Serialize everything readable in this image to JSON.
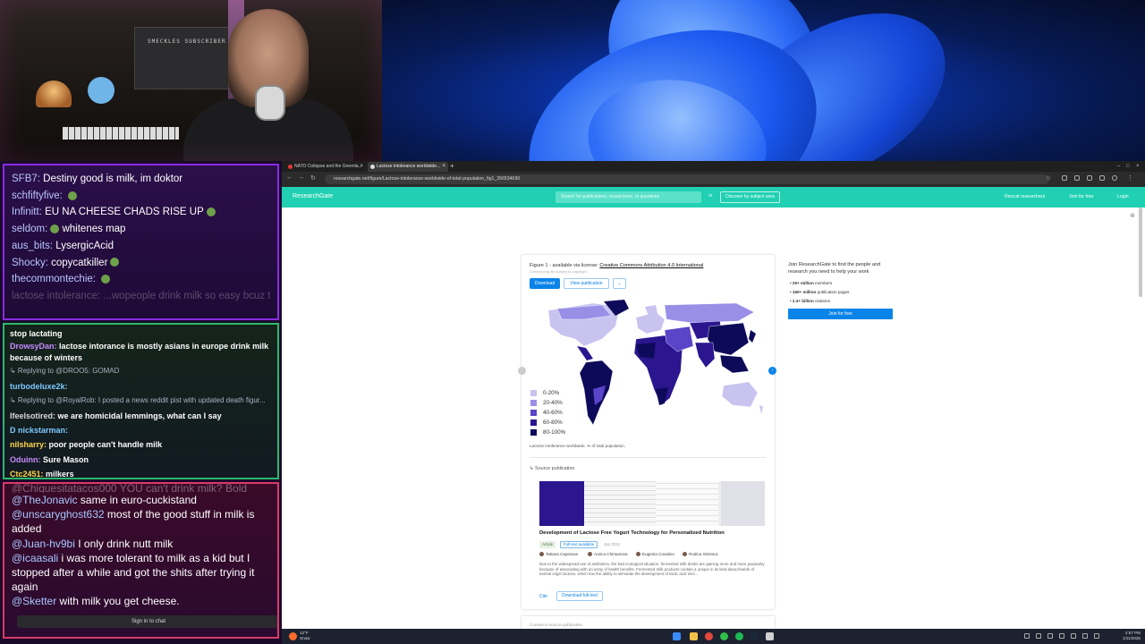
{
  "webcam": {
    "wall_text": "SMECKLES SUBSCRIBER"
  },
  "chat1": {
    "lines": [
      {
        "user": "SFB7:",
        "text": "Destiny good is milk, im doktor",
        "emote": ""
      },
      {
        "user": "schfiftyfive:",
        "text": "",
        "emote": "frog"
      },
      {
        "user": "Infinitt:",
        "text": "EU NA CHEESE CHADS RISE UP",
        "emote": "frog"
      },
      {
        "user": "seldom:",
        "text": "whitenes map",
        "emote": "frog"
      },
      {
        "user": "aus_bits:",
        "text": "LysergicAcid",
        "emote": ""
      },
      {
        "user": "Shocky:",
        "text": "copycatkiller",
        "emote": "frog"
      },
      {
        "user": "thecommontechie:",
        "text": "",
        "emote": "frog"
      }
    ],
    "faded": "lactose intolerance: ...wopeople drink milk so easy bcuz they ***"
  },
  "chat2": {
    "top_cut": "stop lactating",
    "l1_user": "DrowsyDan:",
    "l1_text": "lactose intorance is mostly asians in europe drink milk because of winters",
    "r1": "↳ Replying to @DROO5: GOMAD",
    "l2_user": "turbodeluxe2k:",
    "r2": "↳ Replying to @RoyalRob: I posted a news reddit pist with updated death figur...",
    "l3_user": "Ifeelsotired:",
    "l3_text": "we are homicidal lemmings, what can I say",
    "l4_user": "D nickstarman:",
    "l5_user": "nilsharry:",
    "l5_text": "poor people can't handle milk",
    "l6_user": "Oduinn:",
    "l6_text": "Sure Mason",
    "l7_user": "Ctc2451:",
    "l7_text": "milkers"
  },
  "chat3": {
    "cut": "@Chiquesitatacos000 YOU can't drink milk? Bold",
    "msgs": [
      {
        "user": "@TheJonavic",
        "text": "same in euro-cuckistand"
      },
      {
        "user": "@unscaryghost632",
        "text": "most of the good stuff in milk is added"
      },
      {
        "user": "@Juan-hv9bi",
        "text": "I only drink nutt milk"
      },
      {
        "user": "@icaasali",
        "text": "i was more tolerant to milk as a kid but I stopped after a while and got the shits after trying it again"
      },
      {
        "user": "@Sketter",
        "text": "with milk you get cheese."
      }
    ],
    "signin": "Sign in to chat"
  },
  "browser": {
    "tabs": [
      "NATO Collapse and the Greenla...",
      "Lactose intolerance worldwide..."
    ],
    "url": "researchgate.net/figure/Lactose-intolerance-worldwide-of-total-population_fig1_356534690"
  },
  "rg": {
    "logo": "ResearchGate",
    "search_placeholder": "Search for publications, researchers, or questions",
    "or": "or",
    "discover": "Discover by subject area",
    "recruit": "Recruit researchers",
    "join": "Join for free",
    "login": "Login"
  },
  "figure": {
    "title_prefix": "Figure 1 - available via license:",
    "license": "Creative Commons Attribution 4.0 International",
    "note": "Content may be subject to copyright.",
    "download": "Download",
    "view_pub": "View publication",
    "more": "⌄",
    "legend": [
      {
        "label": "0-20%",
        "color": "#c9c3f0"
      },
      {
        "label": "20-40%",
        "color": "#9a8fe6"
      },
      {
        "label": "40-60%",
        "color": "#5a44c8"
      },
      {
        "label": "60-80%",
        "color": "#2b168f"
      },
      {
        "label": "80-100%",
        "color": "#0e0a5a"
      }
    ],
    "caption": "Lactose intolerance worldwide, % of total population."
  },
  "source": {
    "label": "Source publication",
    "title": "Development of Lactose Free Yogurt Technology for Personalized Nutrition",
    "tag_article": "Article",
    "tag_full": "Full-text available",
    "date": "Jan 2021",
    "authors": [
      "Tatiana Capranan",
      "Aurica Chirsanova",
      "Eugenia Covaliov",
      "Rodica Siminiuc"
    ],
    "abstract": "Due to the widespread use of antibiotics, the bad ecological situation, fermented milk drinks are gaining more and more popularity because of associating with an array of health benefits. Fermented milk products contain a unique in its kind disaccharide of animal origin lactose, which has the ability to stimulate the development of lactic acid micr...",
    "cite": "Cite",
    "download_full": "Download full-text",
    "card2": "Context in source publication"
  },
  "side": {
    "title": "Join ResearchGate to find the people and research you need to help your work",
    "stats": [
      {
        "num": "25+ million",
        "text": "members"
      },
      {
        "num": "160+ million",
        "text": "publication pages"
      },
      {
        "num": "2.3+ billion",
        "text": "citations"
      }
    ],
    "button": "Join for free"
  },
  "taskbar": {
    "temp": "12°F",
    "weather": "Snow",
    "time": "2:57 PM",
    "date": "1/11/2026"
  }
}
